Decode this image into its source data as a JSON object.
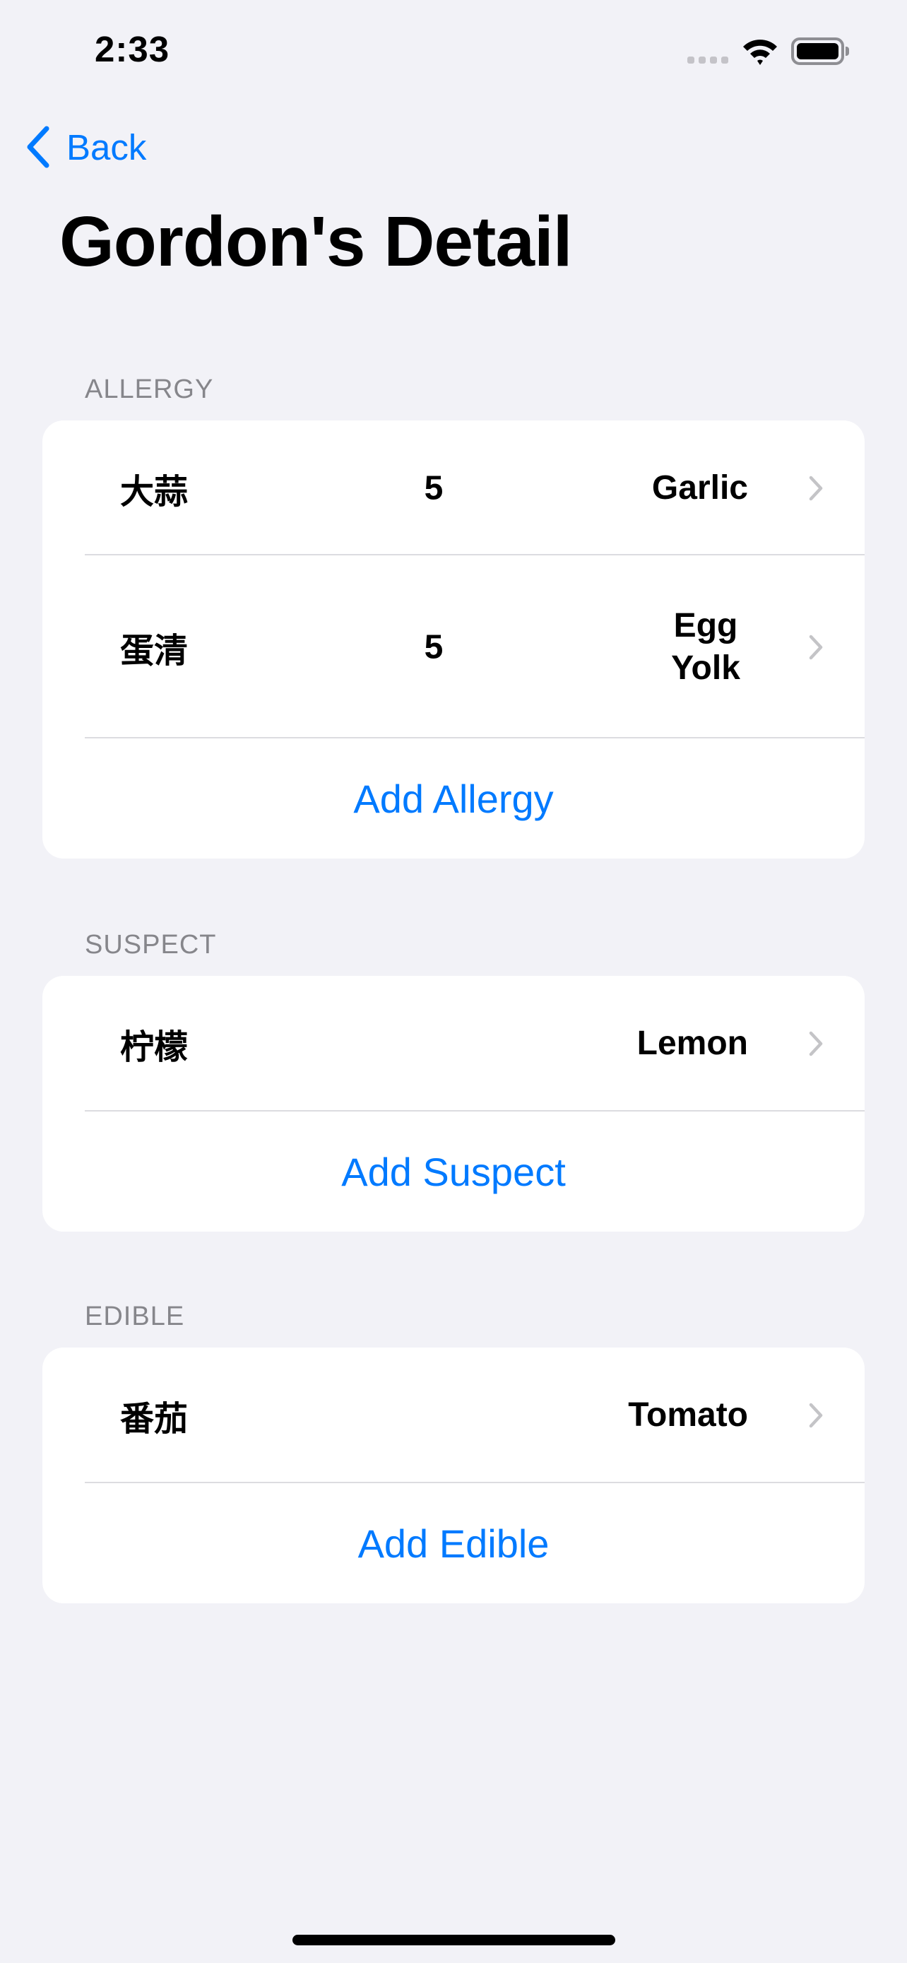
{
  "status_bar": {
    "time": "2:33"
  },
  "nav": {
    "back_label": "Back",
    "title": "Gordon's Detail"
  },
  "sections": [
    {
      "header": "ALLERGY",
      "rows": [
        {
          "chinese": "大蒜",
          "level": "5",
          "english": "Garlic"
        },
        {
          "chinese": "蛋清",
          "level": "5",
          "english": "Egg Yolk"
        }
      ],
      "add_label": "Add Allergy"
    },
    {
      "header": "SUSPECT",
      "rows": [
        {
          "chinese": "柠檬",
          "english": "Lemon"
        }
      ],
      "add_label": "Add Suspect"
    },
    {
      "header": "EDIBLE",
      "rows": [
        {
          "chinese": "番茄",
          "english": "Tomato"
        }
      ],
      "add_label": "Add Edible"
    }
  ],
  "colors": {
    "accent": "#007aff",
    "background": "#f2f2f7"
  }
}
